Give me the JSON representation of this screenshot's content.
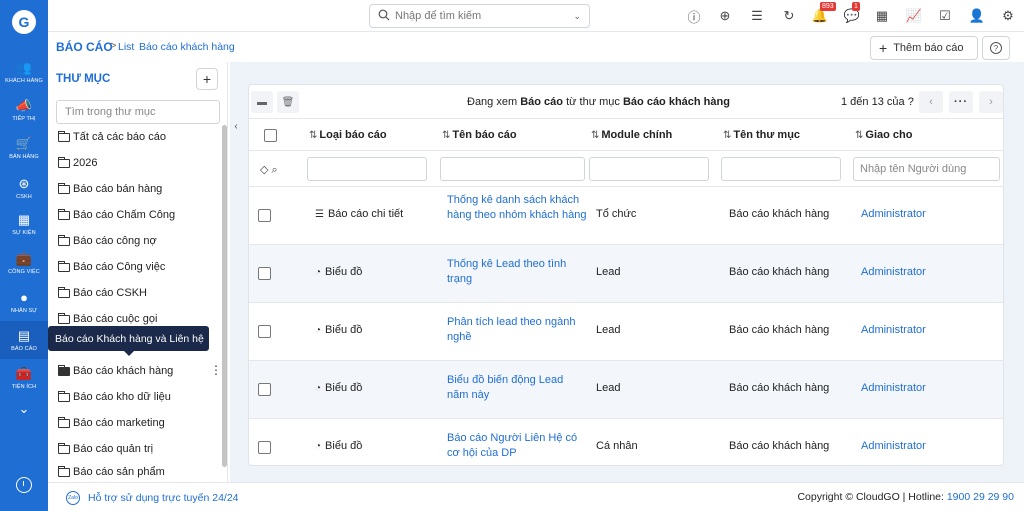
{
  "colors": {
    "brand": "#1f6ed4",
    "nav_bg": "#1f6ed4",
    "badge": "#e53935",
    "tooltip_bg": "#1b2a4a"
  },
  "nav": {
    "items": [
      {
        "label": "KHÁCH HÀNG",
        "icon": "users-icon"
      },
      {
        "label": "TIẾP THỊ",
        "icon": "megaphone-icon"
      },
      {
        "label": "BÁN HÀNG",
        "icon": "cart-icon"
      },
      {
        "label": "CSKH",
        "icon": "lifebuoy-icon"
      },
      {
        "label": "SỰ KIỆN",
        "icon": "calendar-icon"
      },
      {
        "label": "CÔNG VIỆC",
        "icon": "briefcase-icon"
      },
      {
        "label": "NHÂN SỰ",
        "icon": "person-icon"
      },
      {
        "label": "BÁO CÁO",
        "icon": "report-icon"
      },
      {
        "label": "TIỆN ÍCH",
        "icon": "toolbox-icon"
      }
    ]
  },
  "topbar": {
    "search_placeholder": "Nhập để tìm kiếm",
    "notifications_count": "893",
    "messages_count": "1"
  },
  "breadcrumb": {
    "main": "BÁO CÁO",
    "sep": ">",
    "list": "List",
    "current": "Báo cáo khách hàng"
  },
  "actions": {
    "add_label": "Thêm báo cáo",
    "help": "?"
  },
  "folders": {
    "title": "THƯ MỤC",
    "add": "+",
    "search_placeholder": "Tìm trong thư mục",
    "items": [
      "Tất cả các báo cáo",
      "2026",
      "Báo cáo bán hàng",
      "Báo cáo Chấm Công",
      "Báo cáo công nợ",
      "Báo cáo Công việc",
      "Báo cáo CSKH",
      "Báo cáo cuộc gọi",
      "Báo cáo khách hàng",
      "Báo cáo kho dữ liệu",
      "Báo cáo marketing",
      "Báo cáo quản trị",
      "Báo cáo sản phẩm"
    ],
    "tooltip": "Báo cáo Khách hàng và Liên hệ"
  },
  "listview": {
    "viewing_prefix": "Đang xem",
    "viewing_module": "Báo cáo",
    "viewing_mid": "từ thư mục",
    "viewing_folder": "Báo cáo khách hàng",
    "page_info": "1 đến 13 của",
    "page_q": "?",
    "more": "···",
    "columns": [
      "Loại báo cáo",
      "Tên báo cáo",
      "Module chính",
      "Tên thư mục",
      "Giao cho"
    ],
    "assignee_placeholder": "Nhập tên Người dùng",
    "rows": [
      {
        "type": "Báo cáo chi tiết",
        "type_icon": "list-icon",
        "name": "Thống kê danh sách khách hàng theo nhóm khách hàng",
        "module": "Tổ chức",
        "folder": "Báo cáo khách hàng",
        "assignee": "Administrator"
      },
      {
        "type": "Biểu đồ",
        "type_icon": "pie-chart-icon",
        "name": "Thống kê Lead theo tình trạng",
        "module": "Lead",
        "folder": "Báo cáo khách hàng",
        "assignee": "Administrator"
      },
      {
        "type": "Biểu đồ",
        "type_icon": "pie-chart-icon",
        "name": "Phân tích lead theo ngành nghề",
        "module": "Lead",
        "folder": "Báo cáo khách hàng",
        "assignee": "Administrator"
      },
      {
        "type": "Biểu đồ",
        "type_icon": "pie-chart-icon",
        "name": "Biểu đồ biến động Lead năm này",
        "module": "Lead",
        "folder": "Báo cáo khách hàng",
        "assignee": "Administrator"
      },
      {
        "type": "Biểu đồ",
        "type_icon": "pie-chart-icon",
        "name": "Báo cáo Người Liên Hệ có cơ hội của DP",
        "module": "Cá nhân",
        "folder": "Báo cáo khách hàng",
        "assignee": "Administrator"
      }
    ]
  },
  "footer": {
    "zalo": "Zalo",
    "support": "Hỗ trợ sử dụng trực tuyến 24/24",
    "copyright": "Copyright © CloudGO | Hotline:",
    "hotline": "1900 29 29 90"
  }
}
